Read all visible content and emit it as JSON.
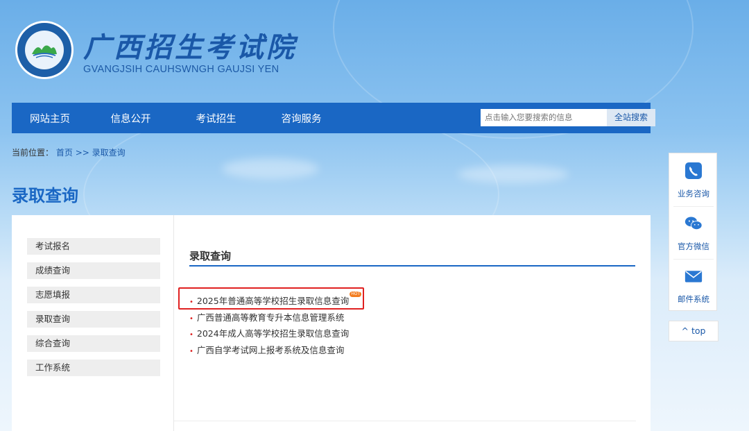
{
  "header": {
    "title": "广西招生考试院",
    "subtitle": "GVANGJSIH CAUHSWNGH GAUJSI YEN"
  },
  "nav": {
    "items": [
      "网站主页",
      "信息公开",
      "考试招生",
      "咨询服务"
    ],
    "search_placeholder": "点击输入您要搜索的信息",
    "search_button": "全站搜索"
  },
  "breadcrumb": {
    "prefix": "当前位置：",
    "home": "首页",
    "separator": ">>",
    "current": "录取查询"
  },
  "page_title": "录取查询",
  "sidebar": {
    "items": [
      "考试报名",
      "成绩查询",
      "志愿填报",
      "录取查询",
      "综合查询",
      "工作系统"
    ]
  },
  "content": {
    "title": "录取查询",
    "links": [
      {
        "text": "2025年普通高等学校招生录取信息查询",
        "badge": "HOT"
      },
      {
        "text": "广西普通高等教育专升本信息管理系统"
      },
      {
        "text": "2024年成人高等学校招生录取信息查询"
      },
      {
        "text": "广西自学考试网上报考系统及信息查询"
      }
    ]
  },
  "float_panel": {
    "items": [
      {
        "label": "业务咨询",
        "icon": "phone-icon"
      },
      {
        "label": "官方微信",
        "icon": "wechat-icon"
      },
      {
        "label": "邮件系统",
        "icon": "mail-icon"
      }
    ],
    "top_label": "top"
  },
  "colors": {
    "brand_blue": "#1a67c4",
    "highlight_red": "#e02020"
  }
}
